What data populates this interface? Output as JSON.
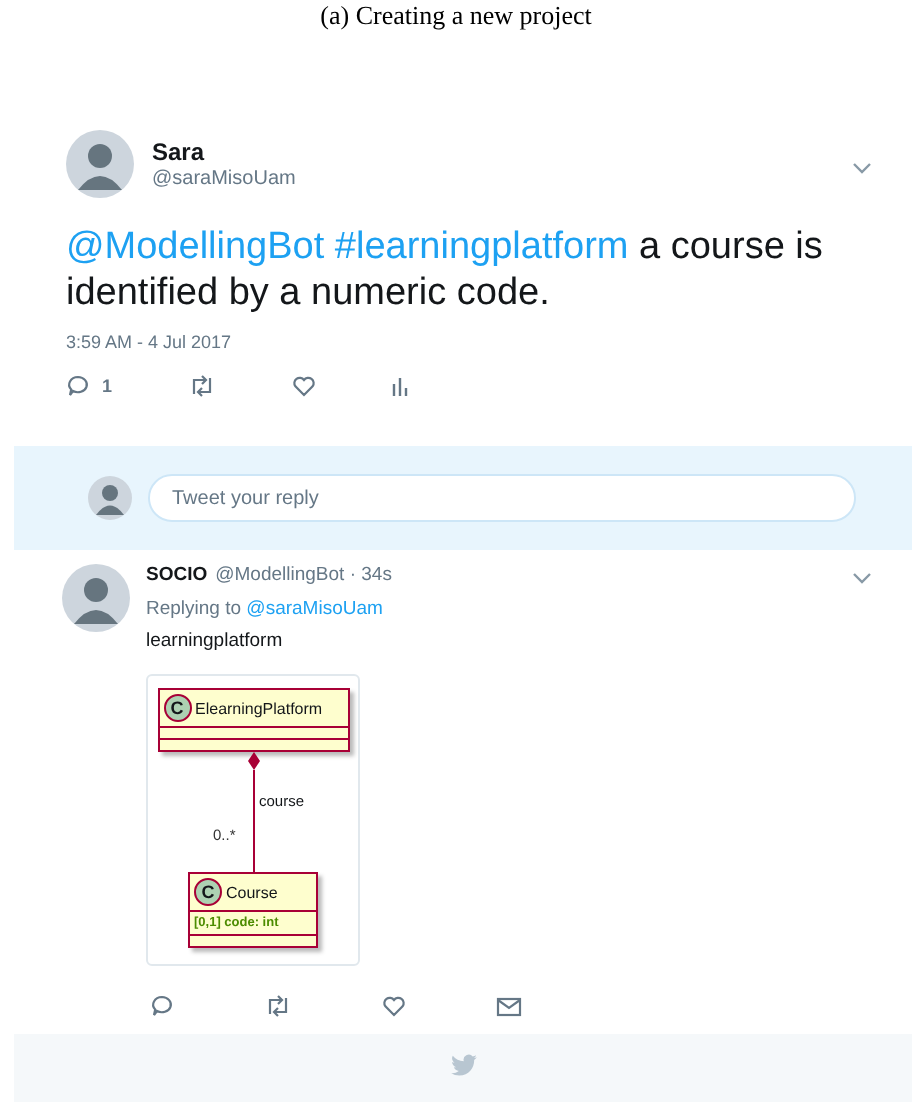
{
  "caption": "(a) Creating a new project",
  "tweet": {
    "name": "Sara",
    "handle": "@saraMisoUam",
    "text": [
      {
        "kind": "mention",
        "text": "@ModellingBot"
      },
      {
        "kind": "hashtag",
        "text": "#learningplatform"
      },
      {
        "kind": "plain",
        "text": "a course is identified by a numeric code."
      }
    ],
    "time": "3:59 AM - 4 Jul 2017",
    "reply_count": "1"
  },
  "reply_box": {
    "placeholder": "Tweet your reply"
  },
  "reply": {
    "name": "SOCIO",
    "meta": "@ModellingBot · 34s",
    "replying_to": "Replying to",
    "replying_handle": "@saraMisoUam",
    "text": "learningplatform",
    "diagram": {
      "classes": [
        {
          "stereotype": "C",
          "name": "ElearningPlatform"
        },
        {
          "stereotype": "C",
          "name": "Course",
          "attributes": [
            "[0,1] code: int"
          ]
        }
      ],
      "association": {
        "role": "course",
        "multiplicity": "0..*"
      }
    }
  }
}
